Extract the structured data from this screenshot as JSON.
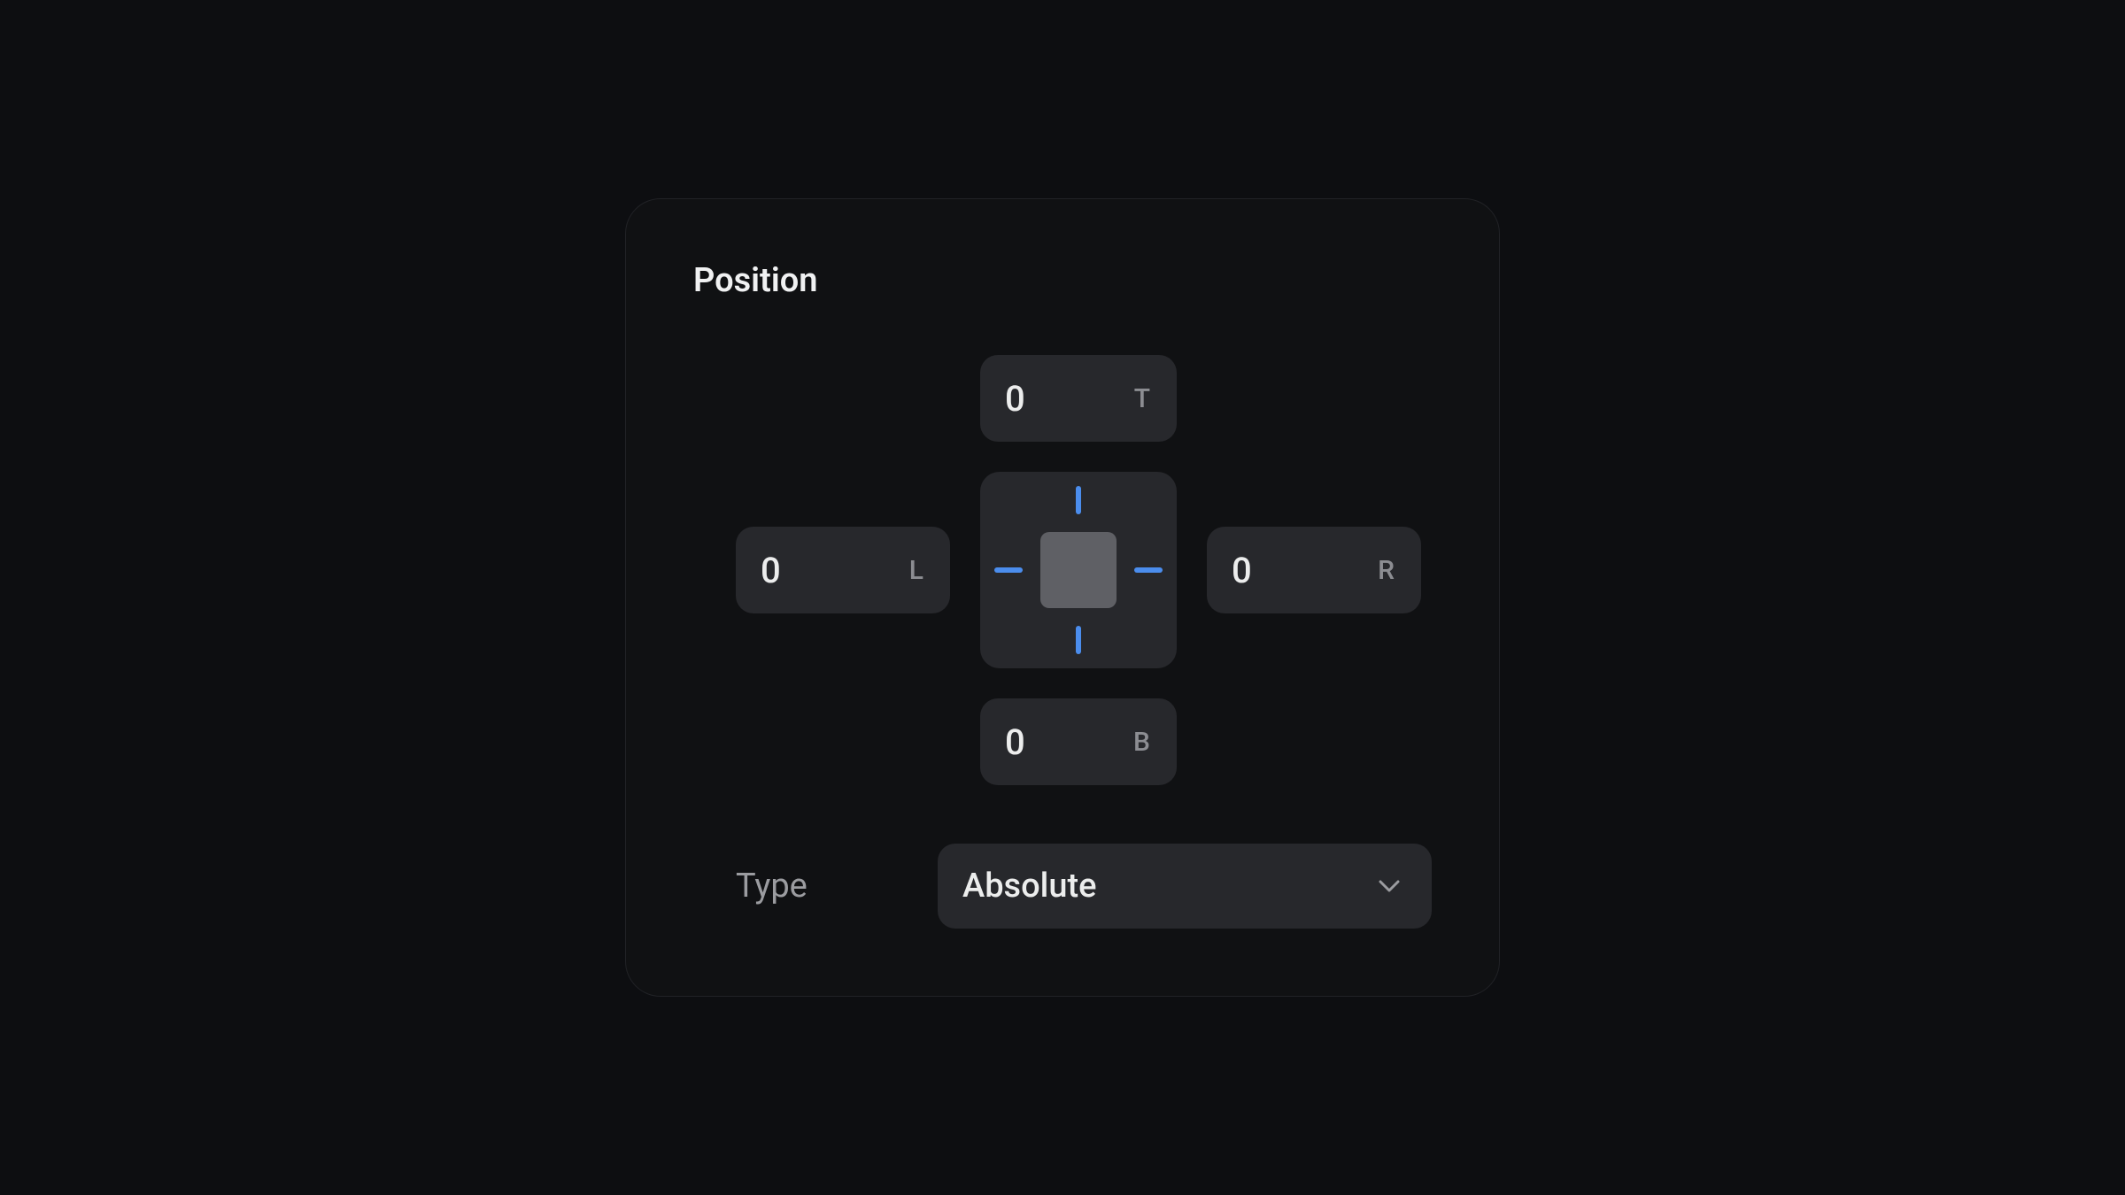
{
  "panel": {
    "title": "Position"
  },
  "offsets": {
    "top": {
      "value": "0",
      "suffix": "T"
    },
    "left": {
      "value": "0",
      "suffix": "L"
    },
    "right": {
      "value": "0",
      "suffix": "R"
    },
    "bottom": {
      "value": "0",
      "suffix": "B"
    }
  },
  "type": {
    "label": "Type",
    "value": "Absolute"
  },
  "colors": {
    "accent": "#4b8ded",
    "background": "#0d0e11",
    "panel": "#101113",
    "field": "#27282c"
  }
}
